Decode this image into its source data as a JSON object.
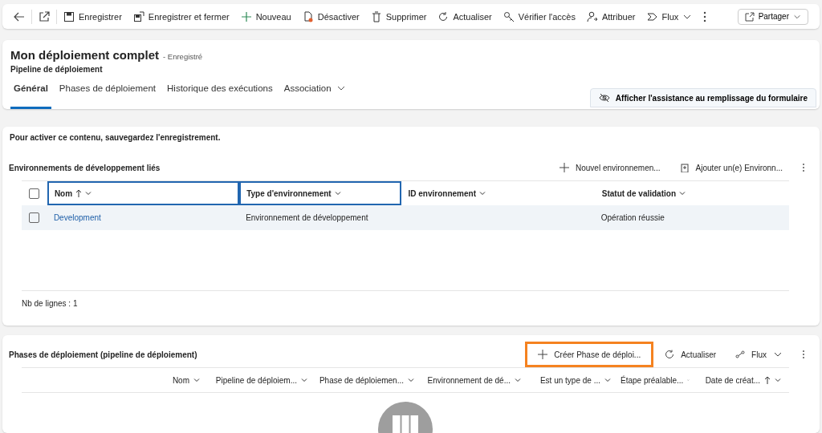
{
  "toolbar": {
    "buttons": [
      {
        "label": "Enregistrer",
        "dropdown": false
      },
      {
        "label": "Enregistrer et fermer",
        "dropdown": false
      },
      {
        "label": "Nouveau",
        "dropdown": false
      },
      {
        "label": "Désactiver",
        "dropdown": false
      },
      {
        "label": "Supprimer",
        "dropdown": false
      },
      {
        "label": "Actualiser",
        "dropdown": false
      },
      {
        "label": "Vérifier l'accès",
        "dropdown": false
      },
      {
        "label": "Attribuer",
        "dropdown": false
      },
      {
        "label": "Flux",
        "dropdown": true
      }
    ],
    "share": "Partager"
  },
  "header": {
    "title": "Mon déploiement complet",
    "status": "- Enregistré",
    "entity": "Pipeline de déploiement",
    "tabs": [
      {
        "label": "Général",
        "selected": true,
        "dropdown": false
      },
      {
        "label": "Phases de déploiement",
        "selected": false,
        "dropdown": false
      },
      {
        "label": "Historique des exécutions",
        "selected": false,
        "dropdown": false
      },
      {
        "label": "Association",
        "selected": false,
        "dropdown": true
      }
    ],
    "assist_button": "Afficher l'assistance au remplissage du formulaire"
  },
  "notice": "Pour activer ce contenu, sauvegardez l'enregistrement.",
  "dev_grid": {
    "title": "Environnements de développement liés",
    "commands": [
      {
        "label": "Nouvel environnemen...",
        "highlighted": false
      },
      {
        "label": "Ajouter un(e) Environn...",
        "highlighted": false
      }
    ],
    "columns": [
      {
        "label": "Nom",
        "sorted": true,
        "focused": true
      },
      {
        "label": "Type d'environnement",
        "sorted": false,
        "focused": true
      },
      {
        "label": "ID environnement",
        "sorted": false,
        "focused": false
      },
      {
        "label": "Statut de validation",
        "sorted": false,
        "focused": false
      }
    ],
    "select_all": {
      "checked": false
    },
    "rows": [
      {
        "checked": false,
        "cells": [
          "Development",
          "Environnement de développement",
          "",
          "Opération réussie"
        ]
      }
    ],
    "footer": "Nb de lignes : 1"
  },
  "stages_grid": {
    "title": "Phases de déploiement (pipeline de déploiement)",
    "commands": [
      {
        "label": "Créer Phase de déploi...",
        "highlighted": true
      },
      {
        "label": "Actualiser",
        "highlighted": false
      },
      {
        "label": "Flux",
        "highlighted": false
      }
    ],
    "columns": [
      {
        "label": "Nom",
        "sorted": false
      },
      {
        "label": "Pipeline de déploiem...",
        "sorted": false
      },
      {
        "label": "Phase de déploiemen...",
        "sorted": false
      },
      {
        "label": "Environnement de dé...",
        "sorted": false
      },
      {
        "label": "Est un type de ...",
        "sorted": false
      },
      {
        "label": "Étape préalable...",
        "sorted": false
      },
      {
        "label": "Date de créat...",
        "sorted": true
      }
    ]
  }
}
